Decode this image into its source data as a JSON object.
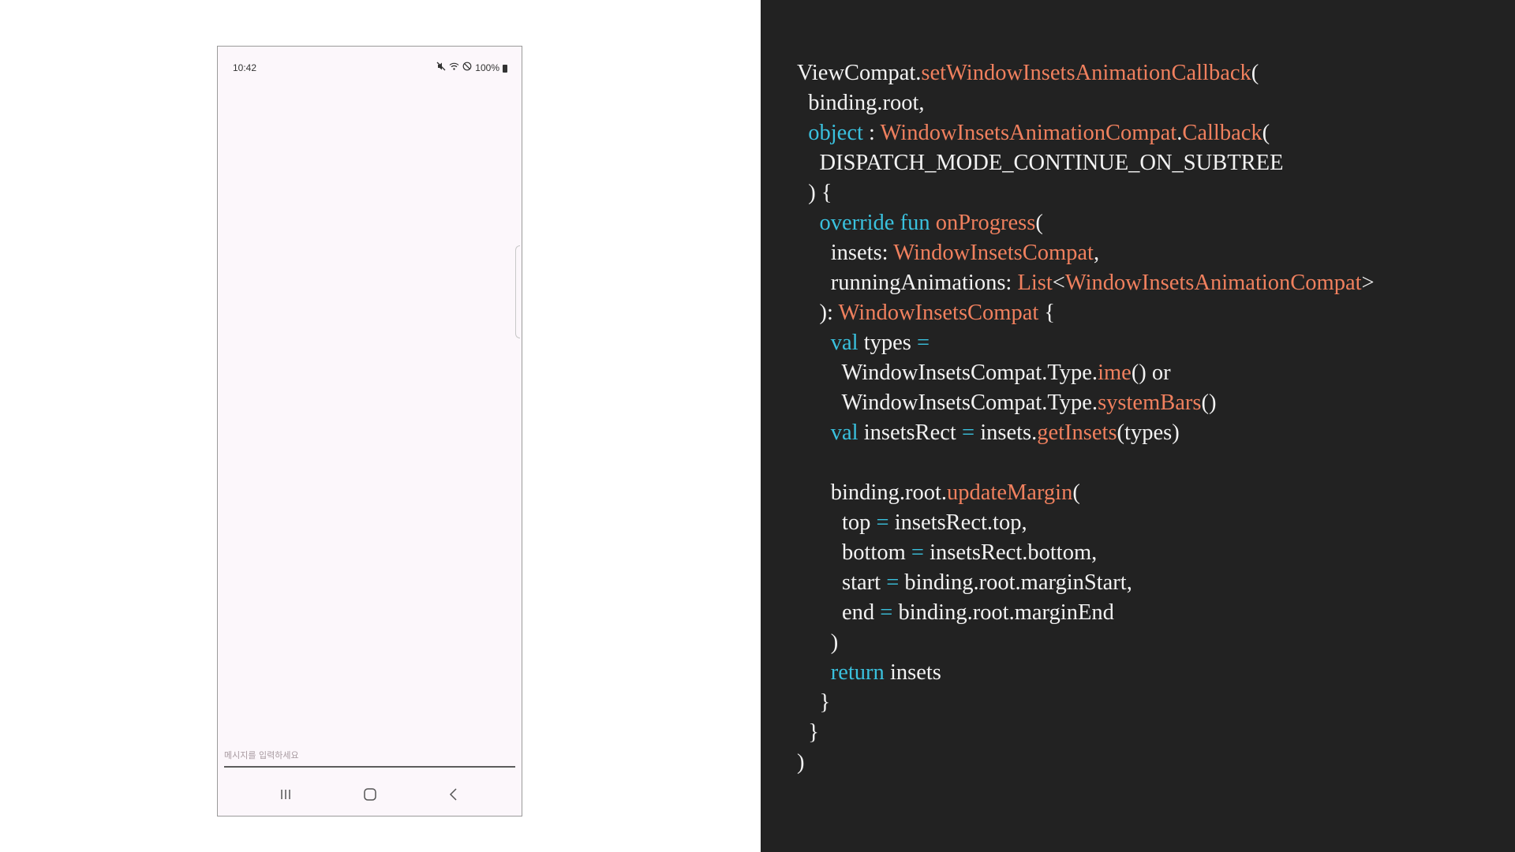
{
  "phone": {
    "status_bar": {
      "time": "10:42",
      "battery_text": "100%",
      "icons": [
        "mute-icon",
        "wifi-icon",
        "do-not-disturb-icon",
        "battery-icon"
      ]
    },
    "message_input": {
      "placeholder": "메시지를 입력하세요",
      "value": ""
    },
    "nav_bar": {
      "buttons": [
        "recents-icon",
        "home-icon",
        "back-icon"
      ]
    },
    "background_color": "#fcf7fb"
  },
  "code_panel": {
    "background_color": "#222222",
    "colors": {
      "plain": "#f2f2f2",
      "keyword": "#3ac1de",
      "function": "#f0805e"
    },
    "lines": [
      [
        {
          "t": "pl",
          "s": "ViewCompat."
        },
        {
          "t": "fn",
          "s": "setWindowInsetsAnimationCallback"
        },
        {
          "t": "pl",
          "s": "("
        }
      ],
      [
        {
          "t": "pl",
          "s": "  binding.root,"
        }
      ],
      [
        {
          "t": "pl",
          "s": "  "
        },
        {
          "t": "kw",
          "s": "object"
        },
        {
          "t": "pl",
          "s": " : "
        },
        {
          "t": "fn",
          "s": "WindowInsetsAnimationCompat"
        },
        {
          "t": "pl",
          "s": "."
        },
        {
          "t": "fn",
          "s": "Callback"
        },
        {
          "t": "pl",
          "s": "("
        }
      ],
      [
        {
          "t": "pl",
          "s": "    DISPATCH_MODE_CONTINUE_ON_SUBTREE"
        }
      ],
      [
        {
          "t": "pl",
          "s": "  ) {"
        }
      ],
      [
        {
          "t": "pl",
          "s": "    "
        },
        {
          "t": "kw",
          "s": "override fun"
        },
        {
          "t": "pl",
          "s": " "
        },
        {
          "t": "fn",
          "s": "onProgress"
        },
        {
          "t": "pl",
          "s": "("
        }
      ],
      [
        {
          "t": "pl",
          "s": "      insets: "
        },
        {
          "t": "fn",
          "s": "WindowInsetsCompat"
        },
        {
          "t": "pl",
          "s": ","
        }
      ],
      [
        {
          "t": "pl",
          "s": "      runningAnimations: "
        },
        {
          "t": "fn",
          "s": "List"
        },
        {
          "t": "pl",
          "s": "<"
        },
        {
          "t": "fn",
          "s": "WindowInsetsAnimationCompat"
        },
        {
          "t": "pl",
          "s": ">"
        }
      ],
      [
        {
          "t": "pl",
          "s": "    ): "
        },
        {
          "t": "fn",
          "s": "WindowInsetsCompat"
        },
        {
          "t": "pl",
          "s": " {"
        }
      ],
      [
        {
          "t": "pl",
          "s": "      "
        },
        {
          "t": "kw",
          "s": "val"
        },
        {
          "t": "pl",
          "s": " types "
        },
        {
          "t": "kw",
          "s": "="
        }
      ],
      [
        {
          "t": "pl",
          "s": "        WindowInsetsCompat.Type."
        },
        {
          "t": "fn",
          "s": "ime"
        },
        {
          "t": "pl",
          "s": "() or"
        }
      ],
      [
        {
          "t": "pl",
          "s": "        WindowInsetsCompat.Type."
        },
        {
          "t": "fn",
          "s": "systemBars"
        },
        {
          "t": "pl",
          "s": "()"
        }
      ],
      [
        {
          "t": "pl",
          "s": "      "
        },
        {
          "t": "kw",
          "s": "val"
        },
        {
          "t": "pl",
          "s": " insetsRect "
        },
        {
          "t": "kw",
          "s": "="
        },
        {
          "t": "pl",
          "s": " insets."
        },
        {
          "t": "fn",
          "s": "getInsets"
        },
        {
          "t": "pl",
          "s": "(types)"
        }
      ],
      [
        {
          "t": "pl",
          "s": ""
        }
      ],
      [
        {
          "t": "pl",
          "s": "      binding.root."
        },
        {
          "t": "fn",
          "s": "updateMargin"
        },
        {
          "t": "pl",
          "s": "("
        }
      ],
      [
        {
          "t": "pl",
          "s": "        top "
        },
        {
          "t": "kw",
          "s": "="
        },
        {
          "t": "pl",
          "s": " insetsRect.top,"
        }
      ],
      [
        {
          "t": "pl",
          "s": "        bottom "
        },
        {
          "t": "kw",
          "s": "="
        },
        {
          "t": "pl",
          "s": " insetsRect.bottom,"
        }
      ],
      [
        {
          "t": "pl",
          "s": "        start "
        },
        {
          "t": "kw",
          "s": "="
        },
        {
          "t": "pl",
          "s": " binding.root.marginStart,"
        }
      ],
      [
        {
          "t": "pl",
          "s": "        end "
        },
        {
          "t": "kw",
          "s": "="
        },
        {
          "t": "pl",
          "s": " binding.root.marginEnd"
        }
      ],
      [
        {
          "t": "pl",
          "s": "      )"
        }
      ],
      [
        {
          "t": "pl",
          "s": "      "
        },
        {
          "t": "kw",
          "s": "return"
        },
        {
          "t": "pl",
          "s": " insets"
        }
      ],
      [
        {
          "t": "pl",
          "s": "    }"
        }
      ],
      [
        {
          "t": "pl",
          "s": "  }"
        }
      ],
      [
        {
          "t": "pl",
          "s": ")"
        }
      ]
    ]
  }
}
